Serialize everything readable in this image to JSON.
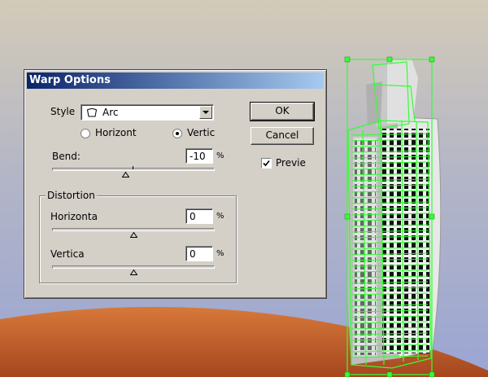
{
  "dialog": {
    "title": "Warp Options",
    "style_label": "Style",
    "style_value": "Arc",
    "orientation_options": [
      "Horizont",
      "Vertic"
    ],
    "orientation_selected": "Vertic",
    "bend_label": "Bend:",
    "bend_value": "-10",
    "bend_slider_value": -10,
    "percent": "%",
    "distortion_title": "Distortion",
    "horizontal_label": "Horizonta",
    "horizontal_value": "0",
    "horizontal_slider_value": 0,
    "vertical_label": "Vertica",
    "vertical_value": "0",
    "vertical_slider_value": 0,
    "ok_label": "OK",
    "cancel_label": "Cancel",
    "preview_label": "Previe",
    "preview_checked": true
  },
  "colors": {
    "titlebar_start": "#0a246a",
    "titlebar_end": "#a6caf0",
    "dialog_bg": "#d4d0c8",
    "selection": "#33ff33",
    "ground": "#c8642e"
  },
  "icons": [
    "arc-warp-icon",
    "chevron-down-icon",
    "checkmark-icon"
  ]
}
